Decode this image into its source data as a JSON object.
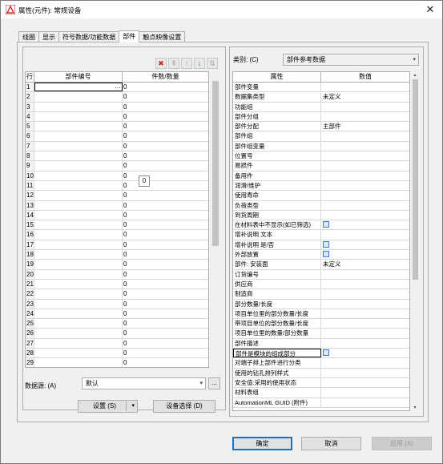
{
  "window": {
    "title": "属性(元件): 常规设备",
    "close_glyph": "✕"
  },
  "tabs": [
    {
      "label": "线圈",
      "active": false
    },
    {
      "label": "显示",
      "active": false
    },
    {
      "label": "符号数据/功能数据",
      "active": false
    },
    {
      "label": "部件",
      "active": true
    },
    {
      "label": "触点映像设置",
      "active": false
    }
  ],
  "toolbar": {
    "delete_icon": "✖",
    "new_icon": "⇞",
    "up_icon": "↑",
    "down_icon": "↓",
    "sort_icon": "⇅"
  },
  "parts_table": {
    "headers": {
      "index": "行",
      "part": "部件编号",
      "qty": "件数/数量"
    },
    "first_part_ellipsis": "…",
    "rows": [
      {
        "i": "1",
        "part": "",
        "qty": "0"
      },
      {
        "i": "2",
        "part": "",
        "qty": "0"
      },
      {
        "i": "3",
        "part": "",
        "qty": "0"
      },
      {
        "i": "4",
        "part": "",
        "qty": "0"
      },
      {
        "i": "5",
        "part": "",
        "qty": "0"
      },
      {
        "i": "6",
        "part": "",
        "qty": "0"
      },
      {
        "i": "7",
        "part": "",
        "qty": "0"
      },
      {
        "i": "8",
        "part": "",
        "qty": "0"
      },
      {
        "i": "9",
        "part": "",
        "qty": "0"
      },
      {
        "i": "10",
        "part": "",
        "qty": "0"
      },
      {
        "i": "11",
        "part": "",
        "qty": "0"
      },
      {
        "i": "12",
        "part": "",
        "qty": "0"
      },
      {
        "i": "13",
        "part": "",
        "qty": "0"
      },
      {
        "i": "14",
        "part": "",
        "qty": "0"
      },
      {
        "i": "15",
        "part": "",
        "qty": "0"
      },
      {
        "i": "16",
        "part": "",
        "qty": "0"
      },
      {
        "i": "17",
        "part": "",
        "qty": "0"
      },
      {
        "i": "18",
        "part": "",
        "qty": "0"
      },
      {
        "i": "19",
        "part": "",
        "qty": "0"
      },
      {
        "i": "20",
        "part": "",
        "qty": "0"
      },
      {
        "i": "21",
        "part": "",
        "qty": "0"
      },
      {
        "i": "22",
        "part": "",
        "qty": "0"
      },
      {
        "i": "23",
        "part": "",
        "qty": "0"
      },
      {
        "i": "24",
        "part": "",
        "qty": "0"
      },
      {
        "i": "25",
        "part": "",
        "qty": "0"
      },
      {
        "i": "26",
        "part": "",
        "qty": "0"
      },
      {
        "i": "27",
        "part": "",
        "qty": "0"
      },
      {
        "i": "28",
        "part": "",
        "qty": "0"
      },
      {
        "i": "29",
        "part": "",
        "qty": "0"
      }
    ],
    "tooltip_value": "0"
  },
  "data_source": {
    "label": "数据源: (A)",
    "value": "默认",
    "browse": "..."
  },
  "buttons": {
    "settings": "设置 (S)",
    "device_select": "设备选择 (D)",
    "ok": "确定",
    "cancel": "取消",
    "apply": "应用 (A)",
    "dropdown_arrow": "▾",
    "scroll_up": "▴",
    "scroll_down": "▾"
  },
  "category": {
    "label": "类别: (C)",
    "value": "部件参考数据"
  },
  "props_table": {
    "headers": {
      "prop": "属性",
      "value": "数值"
    },
    "rows": [
      {
        "prop": "部件变量",
        "value": "",
        "checkbox": false
      },
      {
        "prop": "数据集类型",
        "value": "未定义",
        "checkbox": false
      },
      {
        "prop": "功能组",
        "value": "",
        "checkbox": false
      },
      {
        "prop": "部件分组",
        "value": "",
        "checkbox": false
      },
      {
        "prop": "部件分配",
        "value": "主部件",
        "checkbox": false
      },
      {
        "prop": "部件组",
        "value": "",
        "checkbox": false
      },
      {
        "prop": "部件组变量",
        "value": "",
        "checkbox": false
      },
      {
        "prop": "位置号",
        "value": "",
        "checkbox": false
      },
      {
        "prop": "易损件",
        "value": "",
        "checkbox": false
      },
      {
        "prop": "备用件",
        "value": "",
        "checkbox": false
      },
      {
        "prop": "润滑/维护",
        "value": "",
        "checkbox": false
      },
      {
        "prop": "使用寿命",
        "value": "",
        "checkbox": false
      },
      {
        "prop": "负荷类型",
        "value": "",
        "checkbox": false
      },
      {
        "prop": "到货周期",
        "value": "",
        "checkbox": false
      },
      {
        "prop": "在材料表中不显示(如已筛选)",
        "value": "",
        "checkbox": true
      },
      {
        "prop": "增补说明 文本",
        "value": "",
        "checkbox": false
      },
      {
        "prop": "增补说明 是/否",
        "value": "",
        "checkbox": true
      },
      {
        "prop": "外部放置",
        "value": "",
        "checkbox": true
      },
      {
        "prop": "部件: 安装面",
        "value": "未定义",
        "checkbox": false
      },
      {
        "prop": "订货编号",
        "value": "",
        "checkbox": false
      },
      {
        "prop": "供应商",
        "value": "",
        "checkbox": false
      },
      {
        "prop": "制造商",
        "value": "",
        "checkbox": false
      },
      {
        "prop": "部分数量/长度",
        "value": "",
        "checkbox": false
      },
      {
        "prop": "项目单位里的部分数量/长度",
        "value": "",
        "checkbox": false
      },
      {
        "prop": "带项目单位的部分数量/长度",
        "value": "",
        "checkbox": false
      },
      {
        "prop": "项目单位里的数量/部分数量",
        "value": "",
        "checkbox": false
      },
      {
        "prop": "部件描述",
        "value": "",
        "checkbox": false
      },
      {
        "prop": "部件是模块的组成部分",
        "value": "",
        "checkbox": true,
        "selected": true
      },
      {
        "prop": "对端子排上部件进行分类",
        "value": "",
        "checkbox": false
      },
      {
        "prop": "使用的钻孔排列样式",
        "value": "",
        "checkbox": false
      },
      {
        "prop": "安全值:采用的使用状态",
        "value": "",
        "checkbox": false
      },
      {
        "prop": "材料表组",
        "value": "",
        "checkbox": false
      },
      {
        "prop": "AutomationML GUID (附件)",
        "value": "",
        "checkbox": false
      }
    ]
  },
  "colors": {
    "accent": "#0078d7",
    "delete": "#d32323",
    "window_bg": "#f0f0f0"
  }
}
